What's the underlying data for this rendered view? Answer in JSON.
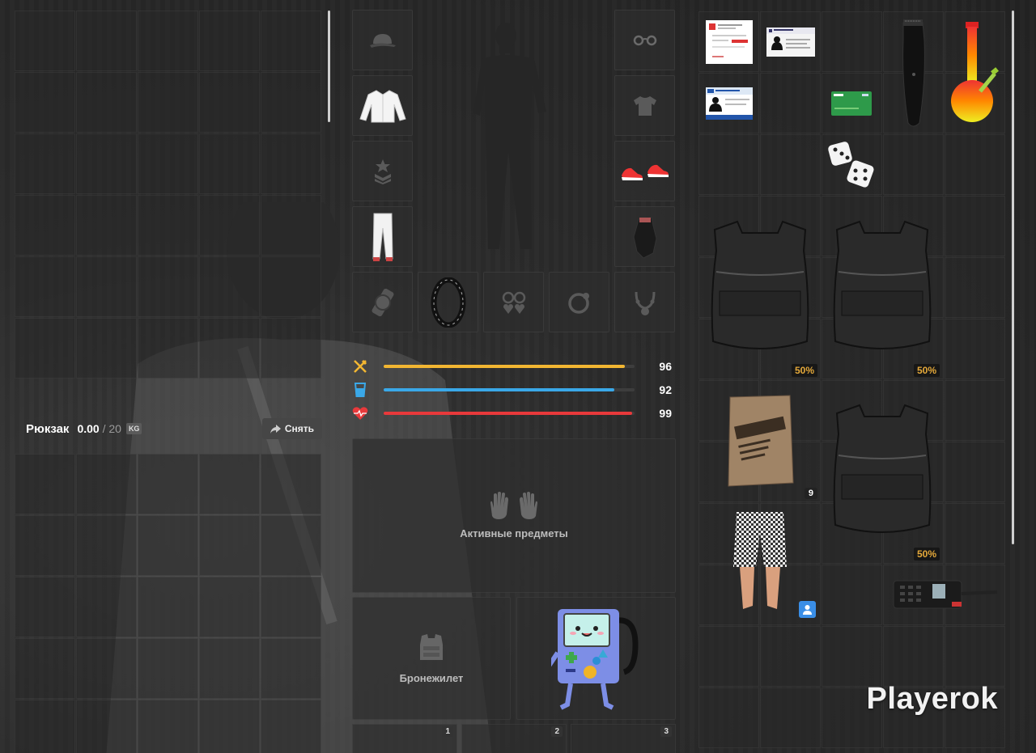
{
  "backpack": {
    "title": "Рюкзак",
    "weight_current": "0.00",
    "weight_sep": " / ",
    "weight_max": "20",
    "unit": "KG",
    "takeoff_label": "Снять"
  },
  "equipment": {
    "slots": [
      "cap-icon",
      "glasses-icon",
      "jacket-icon",
      "tshirt-icon",
      "badge-icon",
      "sneakers-icon",
      "pants-icon",
      "glove-icon",
      "watch-icon",
      "bracelet-icon",
      "earrings-icon",
      "ring-icon",
      "necklace-icon"
    ]
  },
  "stats": [
    {
      "name": "hunger",
      "icon": "fork-knife-icon",
      "value": 96,
      "color": "#f2b632"
    },
    {
      "name": "thirst",
      "icon": "water-glass-icon",
      "value": 92,
      "color": "#3aa8e8"
    },
    {
      "name": "health",
      "icon": "heart-pulse-icon",
      "value": 99,
      "color": "#e8393b"
    }
  ],
  "active_items": {
    "label": "Активные предметы",
    "icon": "hands-icon"
  },
  "armor": {
    "label": "Бронежилет",
    "icon": "vest-icon"
  },
  "hotbar": [
    "1",
    "2",
    "3"
  ],
  "inventory": {
    "items": [
      {
        "name": "document-red-item",
        "badge": ""
      },
      {
        "name": "id-card-item",
        "badge": ""
      },
      {
        "name": "trimmer-item",
        "badge": ""
      },
      {
        "name": "bong-item",
        "badge": ""
      },
      {
        "name": "license-card-item",
        "badge": ""
      },
      {
        "name": "green-card-item",
        "badge": ""
      },
      {
        "name": "dice-item",
        "badge": ""
      },
      {
        "name": "vest-item-1",
        "badge": "50%"
      },
      {
        "name": "vest-item-2",
        "badge": "50%"
      },
      {
        "name": "mre-ration-item",
        "badge": "9"
      },
      {
        "name": "vest-item-3",
        "badge": "50%"
      },
      {
        "name": "shorts-item",
        "badge": "user-icon"
      },
      {
        "name": "radio-item",
        "badge": ""
      }
    ]
  },
  "watermark": "Playerok",
  "colors": {
    "accent_orange": "#e5a93a",
    "user_badge": "#3a8ee6"
  }
}
